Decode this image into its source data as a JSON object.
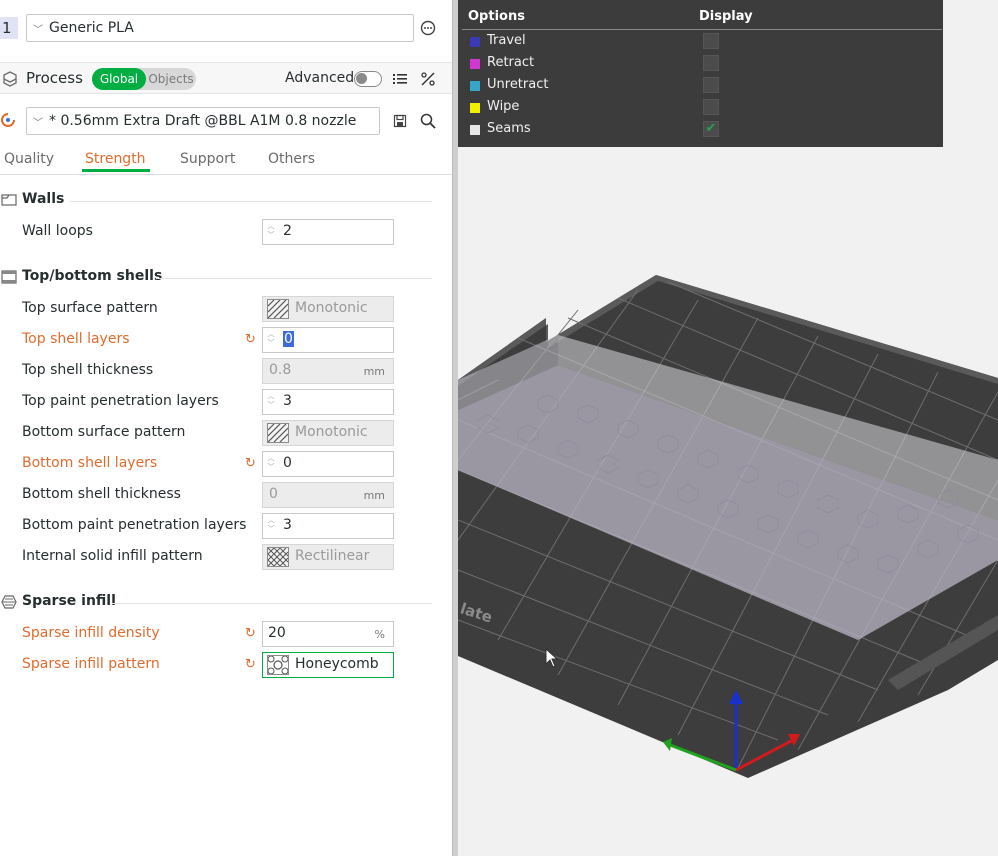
{
  "filament": {
    "plate_index": "1",
    "selected": "Generic PLA"
  },
  "process": {
    "title": "Process",
    "scope_options": [
      "Global",
      "Objects"
    ],
    "advanced_label": "Advanced",
    "preset": "* 0.56mm Extra Draft @BBL A1M 0.8 nozzle"
  },
  "tabs": [
    "Quality",
    "Strength",
    "Support",
    "Others"
  ],
  "active_tab": "Strength",
  "sections": {
    "walls": "Walls",
    "topbottom": "Top/bottom shells",
    "sparse": "Sparse infill"
  },
  "settings": {
    "wall_loops": {
      "label": "Wall loops",
      "value": "2"
    },
    "top_surface_pattern": {
      "label": "Top surface pattern",
      "value": "Monotonic"
    },
    "top_shell_layers": {
      "label": "Top shell layers",
      "value": "0"
    },
    "top_shell_thickness": {
      "label": "Top shell thickness",
      "value": "0.8",
      "unit": "mm"
    },
    "top_paint_penetration_layers": {
      "label": "Top paint penetration layers",
      "value": "3"
    },
    "bottom_surface_pattern": {
      "label": "Bottom surface pattern",
      "value": "Monotonic"
    },
    "bottom_shell_layers": {
      "label": "Bottom shell layers",
      "value": "0"
    },
    "bottom_shell_thickness": {
      "label": "Bottom shell thickness",
      "value": "0",
      "unit": "mm"
    },
    "bottom_paint_penetration_layers": {
      "label": "Bottom paint penetration layers",
      "value": "3"
    },
    "internal_solid_infill_pattern": {
      "label": "Internal solid infill pattern",
      "value": "Rectilinear"
    },
    "sparse_infill_density": {
      "label": "Sparse infill density",
      "value": "20",
      "unit": "%"
    },
    "sparse_infill_pattern": {
      "label": "Sparse infill pattern",
      "value": "Honeycomb"
    }
  },
  "legend": {
    "col_options": "Options",
    "col_display": "Display",
    "items": [
      {
        "label": "Travel",
        "color": "#3a3ab8",
        "checked": false
      },
      {
        "label": "Retract",
        "color": "#d236d2",
        "checked": false
      },
      {
        "label": "Unretract",
        "color": "#37a5c8",
        "checked": false
      },
      {
        "label": "Wipe",
        "color": "#f0f000",
        "checked": false
      },
      {
        "label": "Seams",
        "color": "#e6e6e6",
        "checked": true
      }
    ],
    "check_mark": "✔"
  },
  "bed": {
    "brand_text": "late"
  },
  "colors": {
    "accent_green": "#00ae42",
    "modified_orange": "#e06b2d"
  }
}
